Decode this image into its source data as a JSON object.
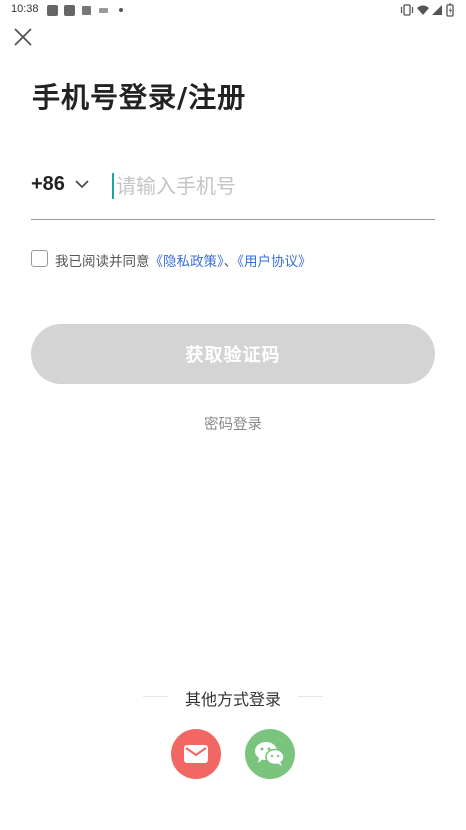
{
  "status_bar": {
    "time": "10:38"
  },
  "header": {
    "title": "手机号登录/注册"
  },
  "phone": {
    "country_code": "+86",
    "placeholder": "请输入手机号",
    "value": ""
  },
  "agreement": {
    "checked": false,
    "prefix": "我已阅读并同意",
    "privacy_link": "《隐私政策》",
    "separator": "、",
    "user_link": "《用户协议》"
  },
  "actions": {
    "get_code_label": "获取验证码",
    "password_login_label": "密码登录"
  },
  "other_login": {
    "label": "其他方式登录",
    "methods": [
      "mail-icon",
      "wechat-icon"
    ]
  },
  "colors": {
    "link": "#3a6fd8",
    "button_disabled": "#d4d4d4",
    "mail": "#f26663",
    "wechat": "#7bc47e",
    "caret": "#1aa5a5"
  }
}
